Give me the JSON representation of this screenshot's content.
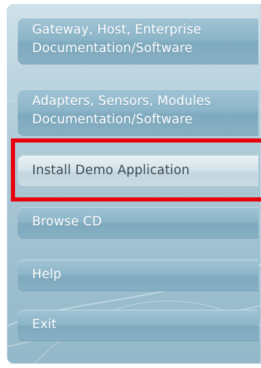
{
  "menu": {
    "items": [
      {
        "line1": "Gateway, Host, Enterprise",
        "line2": "Documentation/Software"
      },
      {
        "line1": "Adapters, Sensors, Modules",
        "line2": "Documentation/Software"
      },
      {
        "label": "Install Demo Application"
      },
      {
        "label": "Browse CD"
      },
      {
        "label": "Help"
      },
      {
        "label": "Exit"
      }
    ],
    "highlighted_index": 2
  },
  "colors": {
    "highlight_border": "#e8000a",
    "button_text": "#ffffff",
    "active_button_text": "#3a4a52"
  }
}
